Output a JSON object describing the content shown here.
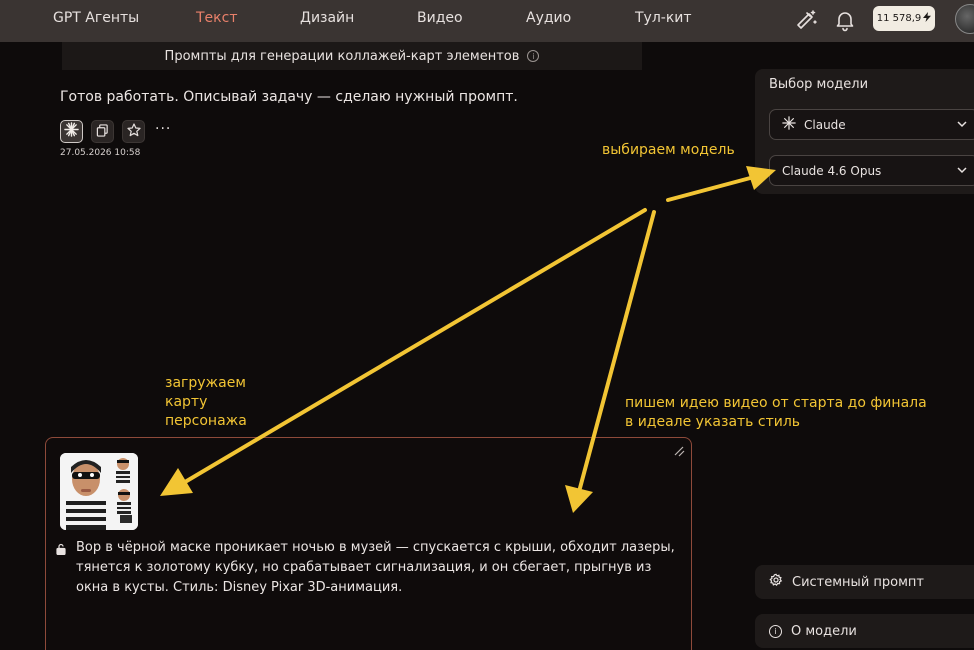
{
  "nav": {
    "items": [
      "GPT Агенты",
      "Текст",
      "Дизайн",
      "Видео",
      "Аудио",
      "Тул-кит"
    ],
    "active_index": 1,
    "balance": "11 578,9"
  },
  "subtitle": {
    "text": "Промпты для генерации коллажей-карт элементов",
    "info_icon": "i"
  },
  "message": {
    "text": "Готов работать. Описывай задачу — сделаю нужный промпт.",
    "more_label": "···",
    "timestamp": "27.05.2026 10:58"
  },
  "model_panel": {
    "title": "Выбор модели",
    "provider": "Claude",
    "model": "Claude 4.6 Opus"
  },
  "system_prompt": {
    "label": "Системный промпт"
  },
  "about_model": {
    "label": "О модели",
    "info_icon": "i"
  },
  "input": {
    "text": "Вор в чёрной маске проникает ночью в музей — спускается с крыши, обходит лазеры, тянется к золотому кубку, но срабатывает сигнализация, и он сбегает, прыгнув из окна в кусты. Стиль: Disney Pixar 3D-анимация."
  },
  "annotations": {
    "choose_model": "выбираем модель",
    "upload_line1": "загружаем",
    "upload_line2": "карту",
    "upload_line3": "персонажа",
    "idea_line1": "пишем идею видео от старта до финала",
    "idea_line2": "в идеале указать стиль"
  },
  "colors": {
    "accent": "#e8806a",
    "annotation": "#f2c534",
    "input_border": "#8e4a3a"
  }
}
